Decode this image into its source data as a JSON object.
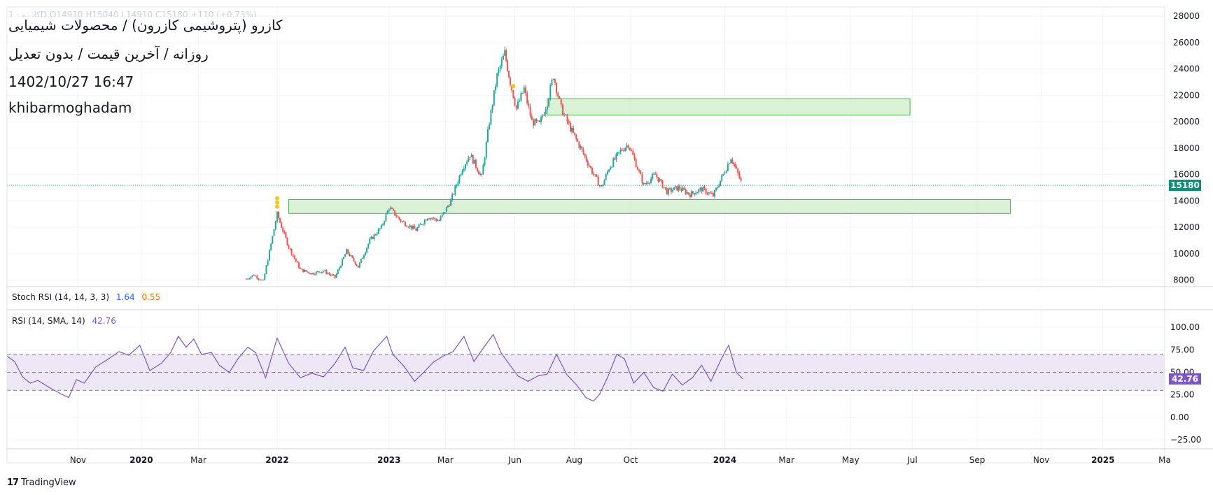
{
  "header": {
    "symbol_line": "کازرو (پتروشیمی کازرون) / محصولات شیمیایی",
    "settings_line": "روزانه / آخرین قیمت / بدون تعدیل",
    "datetime": "1402/10/27 16:47",
    "author": "khibarmoghadam",
    "ohlc_faint": "کازرو · 1D O14910 H15040 L14910 C15180 +110 (+0.73%)"
  },
  "footer": {
    "brand": "TradingView",
    "logo_icon": "tradingview-logo-icon"
  },
  "colors": {
    "up": "#26a69a",
    "down": "#ef5350",
    "grid": "#f0f3fa",
    "zone_fill": "#d6f0d2",
    "zone_stroke": "#4caf50",
    "rsi_line": "#7e57c2",
    "rsi_band": "#ede7f6",
    "price_line": "#0d8e7a",
    "marker": "#f5c518",
    "stoch_k": "#2962ff",
    "stoch_d": "#ff6d00"
  },
  "chart_data": [
    {
      "type": "candlestick",
      "y_axis_ticks": [
        8000,
        10000,
        12000,
        14000,
        16000,
        18000,
        20000,
        22000,
        24000,
        26000,
        28000
      ],
      "ylim": [
        7500,
        28700
      ],
      "last_price": 15180,
      "last_price_label": "15180",
      "time_axis_labels": [
        "Nov",
        "2020",
        "Mar",
        "2022",
        "2023",
        "Mar",
        "Jun",
        "Aug",
        "Oct",
        "2024",
        "Mar",
        "May",
        "Jul",
        "Sep",
        "Nov",
        "2025",
        "Ma"
      ],
      "time_axis_bold": [
        "2020",
        "2022",
        "2023",
        "2024",
        "2025"
      ],
      "x_index_range": [
        0,
        1500
      ],
      "time_axis_positions": [
        92,
        174,
        248,
        350,
        495,
        568,
        658,
        735,
        808,
        930,
        1010,
        1093,
        1173,
        1257,
        1340,
        1420,
        1500
      ],
      "price_path": [
        [
          310,
          8100
        ],
        [
          320,
          8400
        ],
        [
          332,
          7900
        ],
        [
          350,
          13000
        ],
        [
          365,
          10500
        ],
        [
          380,
          8800
        ],
        [
          395,
          8500
        ],
        [
          410,
          8700
        ],
        [
          425,
          8200
        ],
        [
          440,
          10200
        ],
        [
          455,
          9000
        ],
        [
          470,
          11000
        ],
        [
          485,
          12000
        ],
        [
          495,
          13500
        ],
        [
          510,
          12500
        ],
        [
          530,
          11800
        ],
        [
          545,
          12800
        ],
        [
          560,
          12500
        ],
        [
          575,
          14000
        ],
        [
          590,
          16500
        ],
        [
          600,
          17500
        ],
        [
          615,
          15800
        ],
        [
          625,
          20000
        ],
        [
          635,
          23500
        ],
        [
          645,
          25200
        ],
        [
          652,
          23000
        ],
        [
          660,
          21000
        ],
        [
          670,
          22500
        ],
        [
          680,
          20000
        ],
        [
          690,
          19800
        ],
        [
          700,
          21500
        ],
        [
          708,
          23500
        ],
        [
          718,
          21000
        ],
        [
          730,
          19500
        ],
        [
          745,
          17800
        ],
        [
          760,
          16000
        ],
        [
          770,
          15000
        ],
        [
          780,
          16500
        ],
        [
          795,
          17800
        ],
        [
          805,
          18300
        ],
        [
          815,
          16800
        ],
        [
          825,
          15200
        ],
        [
          840,
          16000
        ],
        [
          855,
          14700
        ],
        [
          870,
          15000
        ],
        [
          885,
          14500
        ],
        [
          900,
          14900
        ],
        [
          915,
          14400
        ],
        [
          928,
          16000
        ],
        [
          938,
          17300
        ],
        [
          945,
          16300
        ],
        [
          953,
          15180
        ]
      ],
      "supply_demand_zones": [
        {
          "x0": 365,
          "x1": 1300,
          "y0": 13050,
          "y1": 14100
        },
        {
          "x0": 700,
          "x1": 1170,
          "y0": 20500,
          "y1": 21750
        }
      ],
      "signal_markers": [
        {
          "x": 350,
          "price": 14200,
          "count": 3
        },
        {
          "x": 656,
          "price": 22700,
          "count": 1
        }
      ]
    },
    {
      "type": "line",
      "name": "Stoch RSI",
      "legend_label": "Stoch RSI (14, 14, 3, 3)",
      "k_value": "1.64",
      "d_value": "0.55"
    },
    {
      "type": "line",
      "name": "RSI",
      "legend_label": "RSI (14, SMA, 14)",
      "value": "42.76",
      "last_value_label": "42.76",
      "y_axis_ticks": [
        "100.00",
        "75.00",
        "50.00",
        "25.00",
        "0.00",
        "−25.00"
      ],
      "y_axis_values": [
        100,
        75,
        50,
        25,
        0,
        -25
      ],
      "ylim": [
        -35,
        118
      ],
      "bands": [
        30,
        50,
        70
      ],
      "series": [
        [
          0,
          68
        ],
        [
          10,
          62
        ],
        [
          20,
          45
        ],
        [
          30,
          38
        ],
        [
          40,
          41
        ],
        [
          55,
          33
        ],
        [
          70,
          26
        ],
        [
          80,
          22
        ],
        [
          90,
          42
        ],
        [
          100,
          38
        ],
        [
          115,
          56
        ],
        [
          130,
          64
        ],
        [
          145,
          73
        ],
        [
          158,
          69
        ],
        [
          172,
          80
        ],
        [
          185,
          52
        ],
        [
          200,
          60
        ],
        [
          212,
          72
        ],
        [
          222,
          90
        ],
        [
          232,
          78
        ],
        [
          242,
          87
        ],
        [
          252,
          70
        ],
        [
          265,
          72
        ],
        [
          275,
          58
        ],
        [
          288,
          50
        ],
        [
          300,
          66
        ],
        [
          312,
          78
        ],
        [
          322,
          72
        ],
        [
          335,
          44
        ],
        [
          350,
          88
        ],
        [
          365,
          60
        ],
        [
          380,
          44
        ],
        [
          395,
          49
        ],
        [
          410,
          45
        ],
        [
          425,
          60
        ],
        [
          438,
          78
        ],
        [
          448,
          55
        ],
        [
          462,
          52
        ],
        [
          475,
          74
        ],
        [
          492,
          90
        ],
        [
          500,
          70
        ],
        [
          515,
          56
        ],
        [
          528,
          40
        ],
        [
          540,
          50
        ],
        [
          552,
          61
        ],
        [
          565,
          68
        ],
        [
          578,
          73
        ],
        [
          592,
          90
        ],
        [
          605,
          62
        ],
        [
          618,
          78
        ],
        [
          630,
          92
        ],
        [
          640,
          72
        ],
        [
          650,
          60
        ],
        [
          662,
          46
        ],
        [
          675,
          40
        ],
        [
          688,
          46
        ],
        [
          700,
          48
        ],
        [
          712,
          70
        ],
        [
          725,
          48
        ],
        [
          738,
          36
        ],
        [
          750,
          22
        ],
        [
          760,
          18
        ],
        [
          768,
          26
        ],
        [
          778,
          44
        ],
        [
          790,
          70
        ],
        [
          800,
          65
        ],
        [
          812,
          38
        ],
        [
          825,
          50
        ],
        [
          838,
          33
        ],
        [
          850,
          29
        ],
        [
          862,
          48
        ],
        [
          875,
          36
        ],
        [
          888,
          44
        ],
        [
          900,
          58
        ],
        [
          912,
          40
        ],
        [
          925,
          64
        ],
        [
          935,
          80
        ],
        [
          945,
          50
        ],
        [
          953,
          42.76
        ]
      ]
    }
  ]
}
